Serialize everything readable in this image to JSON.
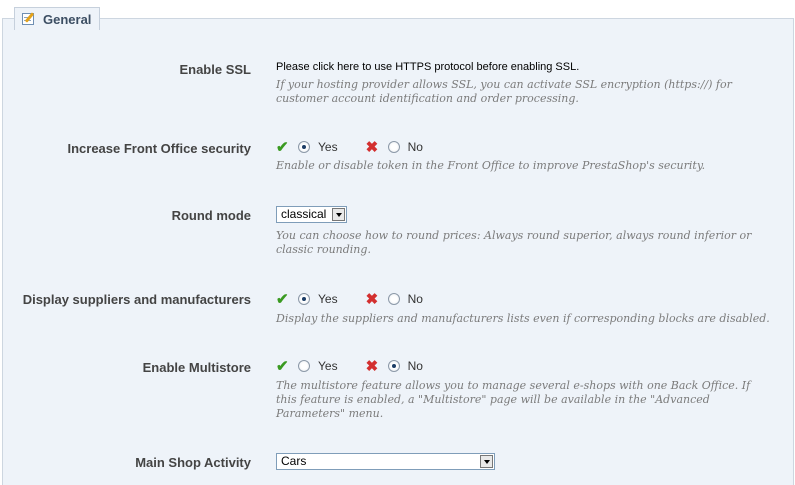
{
  "section": {
    "title": "General"
  },
  "ssl": {
    "label": "Enable SSL",
    "link_text": "Please click here to use HTTPS protocol before enabling SSL.",
    "hint": "If your hosting provider allows SSL, you can activate SSL encryption (https://) for customer account identification and order processing."
  },
  "front_security": {
    "label": "Increase Front Office security",
    "yes_label": "Yes",
    "no_label": "No",
    "selected": "Yes",
    "hint": "Enable or disable token in the Front Office to improve PrestaShop's security."
  },
  "round_mode": {
    "label": "Round mode",
    "value": "classical",
    "hint": "You can choose how to round prices: Always round superior, always round inferior or classic rounding."
  },
  "suppliers": {
    "label": "Display suppliers and manufacturers",
    "yes_label": "Yes",
    "no_label": "No",
    "selected": "Yes",
    "hint": "Display the suppliers and manufacturers lists even if corresponding blocks are disabled."
  },
  "multistore": {
    "label": "Enable Multistore",
    "yes_label": "Yes",
    "no_label": "No",
    "selected": "No",
    "hint": "The multistore feature allows you to manage several e-shops with one Back Office. If this feature is enabled, a \"Multistore\" page will be available in the \"Advanced Parameters\" menu."
  },
  "shop_activity": {
    "label": "Main Shop Activity",
    "value": "Cars"
  },
  "icons": {
    "legend": "edit-icon",
    "yes": "check-icon",
    "no": "cross-icon"
  }
}
